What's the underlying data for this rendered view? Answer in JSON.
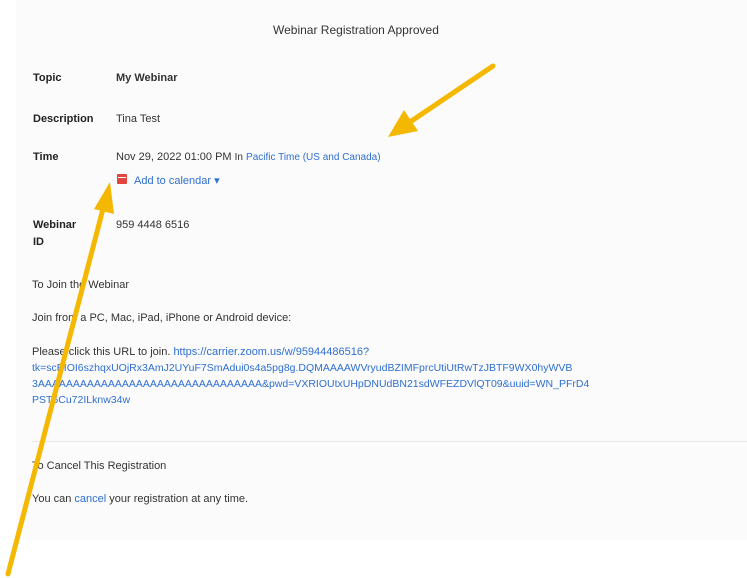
{
  "window": {
    "title": "Webinar Registration Approved"
  },
  "details": {
    "topic_label": "Topic",
    "topic_value": "My Webinar",
    "description_label": "Description",
    "description_value": "Tina Test",
    "time_label": "Time",
    "time_value": "Nov 29, 2022 01:00 PM",
    "time_in": "In",
    "timezone_link": "Pacific Time (US and Canada)",
    "add_to_calendar": "Add to calendar",
    "webinar_id_label_1": "Webinar",
    "webinar_id_label_2": "ID",
    "webinar_id_value": "959 4448 6516"
  },
  "join": {
    "heading": "To Join the Webinar",
    "device_text": "Join from a PC, Mac, iPad, iPhone or Android device:",
    "click_text": "Please click this URL to join.",
    "url_part1": "https://carrier.zoom.us/w/95944486516?",
    "url_part2": "tk=scEIOI6szhqxUOjRx3AmJ2UYuF7SmAdui0s4a5pg8g.DQMAAAAWVryudBZIMFprcUtiUtRwTzJBTF9WX0hyWVB",
    "url_part3": "3AAAAAAAAAAAAAAAAAAAAAAAAAAAAAAAA&pwd=VXRIOUtxUHpDNUdBN21sdWFEZDVlQT09&uuid=WN_PFrD4",
    "url_part4": "PST6Cu72ILknw34w"
  },
  "cancel": {
    "heading": "To Cancel This Registration",
    "text_before": "You can",
    "link": "cancel",
    "text_after": "your registration at any time."
  },
  "colors": {
    "link": "#2e6fd0",
    "arrow": "#f5b800",
    "calendar_icon": "#e0463d"
  }
}
